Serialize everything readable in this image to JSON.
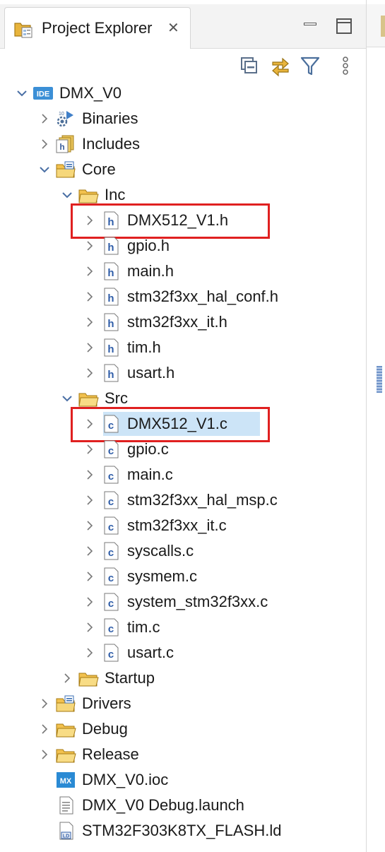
{
  "panel": {
    "tab_title": "Project Explorer",
    "close_glyph": "✕"
  },
  "toolbar": {
    "collapse_all": "collapse-all-icon",
    "link_editor": "link-with-editor-icon",
    "filter": "filter-icon",
    "view_menu": "view-menu-icon"
  },
  "colors": {
    "selection": "#cce4f7",
    "highlight_box": "#e02020",
    "folder": "#e8b43c",
    "ide_badge": "#3b8fd6",
    "mx_badge": "#2a8ad4"
  },
  "tree": {
    "project": "DMX_V0",
    "binaries": "Binaries",
    "includes": "Includes",
    "core": "Core",
    "inc": "Inc",
    "inc_files": [
      "DMX512_V1.h",
      "gpio.h",
      "main.h",
      "stm32f3xx_hal_conf.h",
      "stm32f3xx_it.h",
      "tim.h",
      "usart.h"
    ],
    "src": "Src",
    "src_files": [
      "DMX512_V1.c",
      "gpio.c",
      "main.c",
      "stm32f3xx_hal_msp.c",
      "stm32f3xx_it.c",
      "syscalls.c",
      "sysmem.c",
      "system_stm32f3xx.c",
      "tim.c",
      "usart.c"
    ],
    "startup": "Startup",
    "drivers": "Drivers",
    "debug": "Debug",
    "release": "Release",
    "ioc": "DMX_V0.ioc",
    "launch": "DMX_V0 Debug.launch",
    "ld": "STM32F303K8TX_FLASH.ld"
  }
}
